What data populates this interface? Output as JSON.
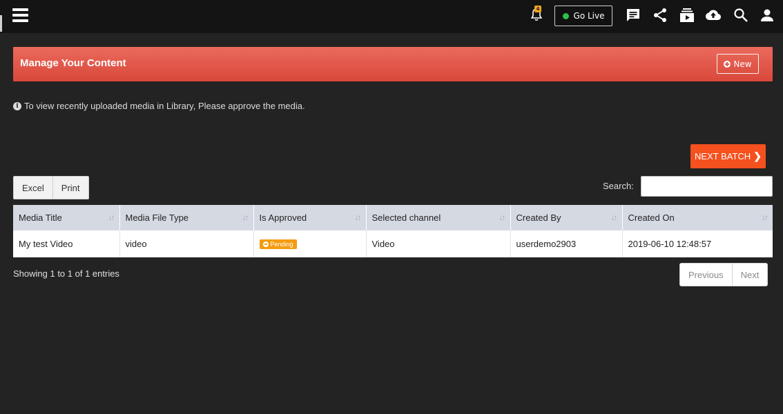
{
  "topbar": {
    "notification_count": "4",
    "go_live_label": "Go Live",
    "icons": [
      "menu-icon",
      "bell-icon",
      "chat-icon",
      "share-icon",
      "video-library-icon",
      "cloud-upload-icon",
      "search-icon",
      "user-icon"
    ]
  },
  "header": {
    "title": "Manage Your Content",
    "new_label": "New"
  },
  "info": {
    "message": "To view recently uploaded media in Library, Please approve the media."
  },
  "next_batch_label": "NEXT BATCH",
  "table_tools": {
    "excel_label": "Excel",
    "print_label": "Print",
    "search_label": "Search:",
    "search_value": ""
  },
  "table": {
    "headers": [
      "Media Title",
      "Media File Type",
      "Is Approved",
      "Selected channel",
      "Created By",
      "Created On"
    ],
    "rows": [
      {
        "media_title": "My test Video",
        "file_type": "video",
        "approved_status": "Pending",
        "channel": "Video",
        "created_by": "userdemo2903",
        "created_on": "2019-06-10 12:48:57"
      }
    ]
  },
  "footer": {
    "showing": "Showing 1 to 1 of 1 entries",
    "previous_label": "Previous",
    "next_label": "Next"
  },
  "colors": {
    "header_red": "#e0564a",
    "next_batch_orange": "#f4511e",
    "pending_orange": "#f39c12",
    "live_green": "#2fbf4a",
    "background": "#232323"
  }
}
